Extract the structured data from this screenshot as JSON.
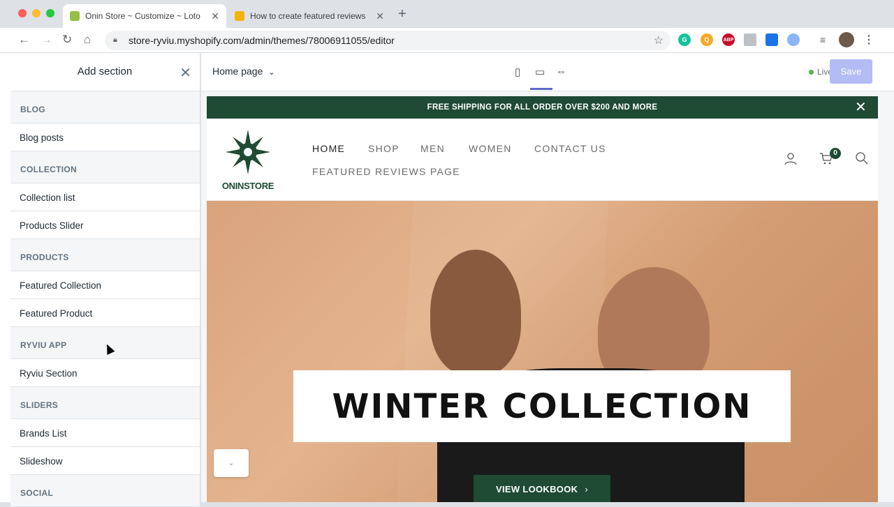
{
  "browser": {
    "tabs": [
      {
        "title": "Onin Store ~ Customize ~ Loto",
        "active": true,
        "favicon": "shopify-icon",
        "favicon_color": "#95bf47"
      },
      {
        "title": "How to create featured reviews",
        "active": false,
        "favicon": "ryviu-icon",
        "favicon_color": "#f4b400"
      }
    ],
    "new_tab": "+",
    "url": "store-ryviu.myshopify.com/admin/themes/78006911055/editor",
    "extensions": [
      {
        "name": "grammarly-icon",
        "label": "G",
        "color": "#15c39a"
      },
      {
        "name": "extension-q-icon",
        "label": "Q",
        "color": "#f9a825"
      },
      {
        "name": "adblock-icon",
        "label": "ABP",
        "color": "#c70d2c"
      },
      {
        "name": "extension-icon",
        "label": "",
        "color": "#9aa0a6"
      },
      {
        "name": "extension-blue-icon",
        "label": "",
        "color": "#1a73e8"
      },
      {
        "name": "extension-person-icon",
        "label": "",
        "color": "#8ab4f8"
      }
    ]
  },
  "sidebar": {
    "title": "Add section",
    "groups": [
      {
        "category": "BLOG",
        "items": [
          "Blog posts"
        ]
      },
      {
        "category": "COLLECTION",
        "items": [
          "Collection list",
          "Products Slider"
        ]
      },
      {
        "category": "PRODUCTS",
        "items": [
          "Featured Collection",
          "Featured Product"
        ]
      },
      {
        "category": "RYVIU APP",
        "items": [
          "Ryviu Section"
        ]
      },
      {
        "category": "SLIDERS",
        "items": [
          "Brands List",
          "Slideshow"
        ]
      },
      {
        "category": "SOCIAL",
        "items": []
      }
    ]
  },
  "editor_bar": {
    "page_select": "Home page",
    "status": "Live",
    "status_color": "#50b83c",
    "save_label": "Save",
    "devices": [
      "mobile",
      "desktop",
      "fullscreen"
    ],
    "active_device": "desktop"
  },
  "store": {
    "announcement": "FREE SHIPPING FOR ALL ORDER OVER $200 AND MORE",
    "logo_text": "ONINSTORE",
    "nav": [
      {
        "label": "HOME",
        "active": true
      },
      {
        "label": "SHOP",
        "active": false
      },
      {
        "label": "MEN",
        "active": false
      },
      {
        "label": "WOMEN",
        "active": false
      },
      {
        "label": "CONTACT US",
        "active": false
      },
      {
        "label": "FEATURED REVIEWS PAGE",
        "active": false
      }
    ],
    "cart_count": "0",
    "hero_title": "WINTER COLLECTION",
    "hero_button": "VIEW LOOKBOOK",
    "brand_color": "#1f4a34"
  }
}
